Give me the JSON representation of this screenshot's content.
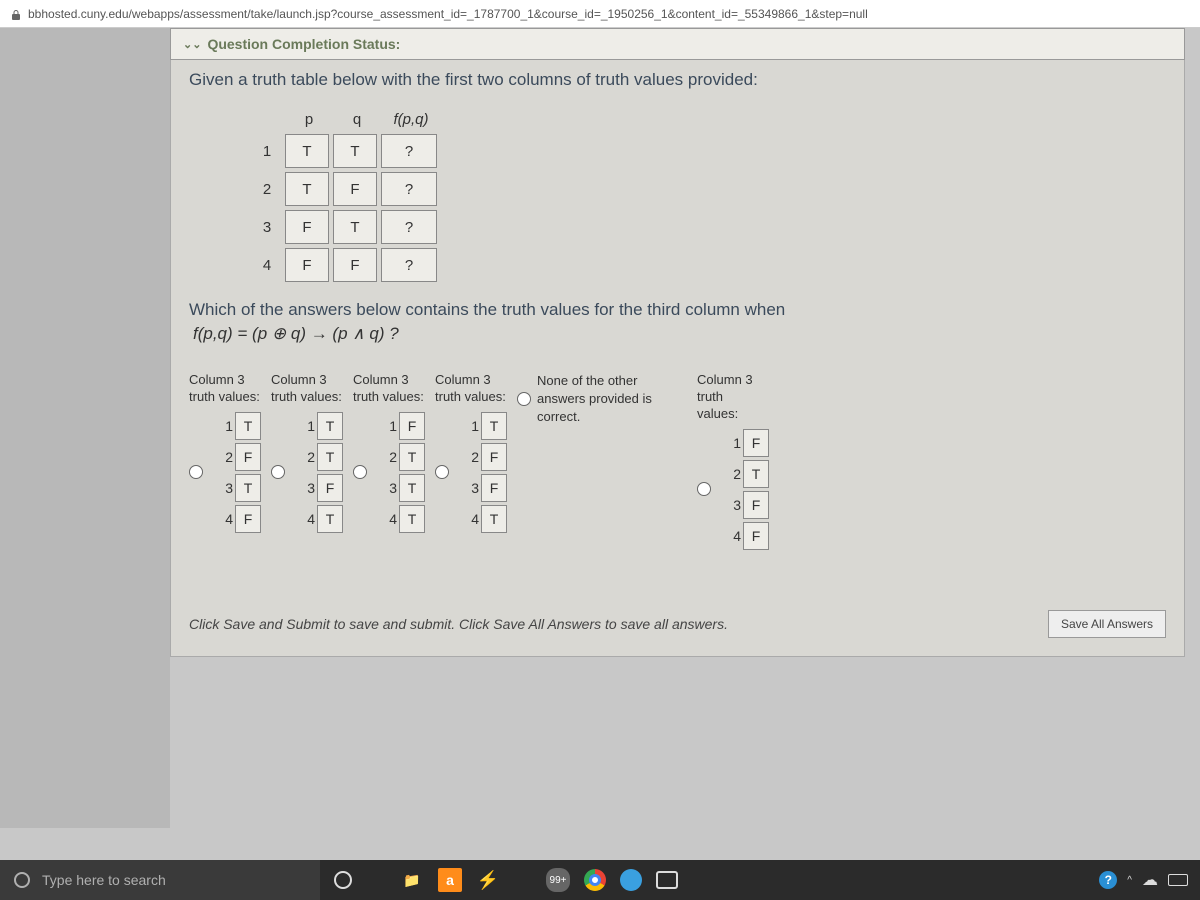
{
  "browser": {
    "url": "bbhosted.cuny.edu/webapps/assessment/take/launch.jsp?course_assessment_id=_1787700_1&course_id=_1950256_1&content_id=_55349866_1&step=null"
  },
  "status": {
    "label": "Question Completion Status:"
  },
  "prompt": "Given a truth table below with the first two columns of truth values provided:",
  "truth_table": {
    "headers": {
      "p": "p",
      "q": "q",
      "fpq": "f(p,q)"
    },
    "rows": [
      {
        "n": "1",
        "p": "T",
        "q": "T",
        "f": "?"
      },
      {
        "n": "2",
        "p": "T",
        "q": "F",
        "f": "?"
      },
      {
        "n": "3",
        "p": "F",
        "q": "T",
        "f": "?"
      },
      {
        "n": "4",
        "p": "F",
        "q": "F",
        "f": "?"
      }
    ]
  },
  "question": "Which of the answers below contains  the truth values for the third column when",
  "formula": "f(p,q) = (p ⊕ q) → (p ∧ q) ?",
  "options": [
    {
      "label": "Column 3\ntruth values:",
      "vals": [
        "T",
        "F",
        "T",
        "F"
      ]
    },
    {
      "label": "Column 3\ntruth values:",
      "vals": [
        "T",
        "T",
        "F",
        "T"
      ]
    },
    {
      "label": "Column 3\ntruth values:",
      "vals": [
        "F",
        "T",
        "T",
        "T"
      ]
    },
    {
      "label": "Column 3\ntruth values:",
      "vals": [
        "T",
        "F",
        "F",
        "T"
      ]
    },
    {
      "none": true,
      "text": "None of the other answers provided is correct."
    },
    {
      "label": "Column 3\ntruth\nvalues:",
      "vals": [
        "F",
        "T",
        "F",
        "F"
      ]
    }
  ],
  "row_nums": [
    "1",
    "2",
    "3",
    "4"
  ],
  "footer": {
    "hint": "Click Save and Submit to save and submit. Click Save All Answers to save all answers.",
    "save_all": "Save All Answers"
  },
  "taskbar": {
    "search_placeholder": "Type here to search",
    "badge": "99+"
  }
}
